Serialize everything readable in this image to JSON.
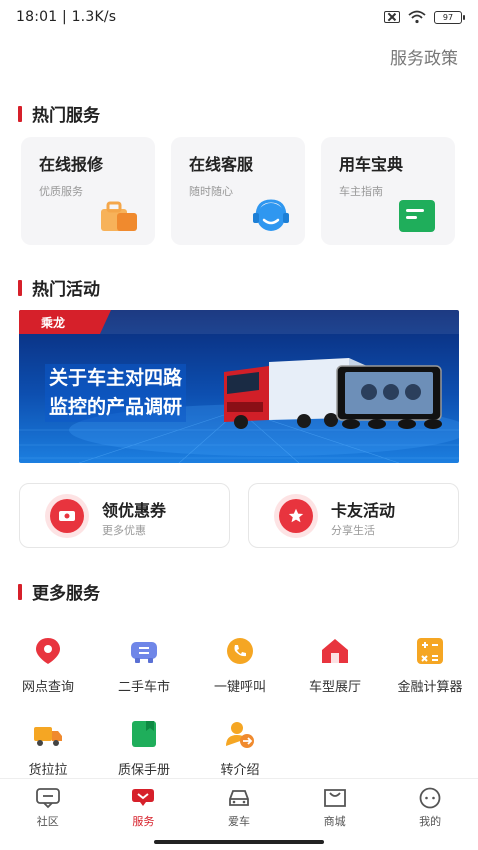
{
  "status_bar": {
    "time": "18:01",
    "speed": "1.3K/s",
    "battery": "97"
  },
  "header": {
    "service_policy": "服务政策"
  },
  "hot_services": {
    "title": "热门服务",
    "cards": [
      {
        "title": "在线报修",
        "subtitle": "优质服务",
        "icon": "toolbox-icon"
      },
      {
        "title": "在线客服",
        "subtitle": "随时随心",
        "icon": "headset-icon"
      },
      {
        "title": "用车宝典",
        "subtitle": "车主指南",
        "icon": "guidebook-icon"
      }
    ]
  },
  "hot_activities": {
    "title": "热门活动",
    "banner": {
      "brand": "乘龙",
      "line1": "关于车主对四路",
      "line2": "监控的产品调研"
    },
    "promos": [
      {
        "title": "领优惠券",
        "subtitle": "更多优惠",
        "icon": "coupon-icon"
      },
      {
        "title": "卡友活动",
        "subtitle": "分享生活",
        "icon": "star-icon"
      }
    ]
  },
  "more_services": {
    "title": "更多服务",
    "items": [
      {
        "label": "网点查询",
        "icon": "location-pin-icon"
      },
      {
        "label": "二手车市",
        "icon": "used-car-icon"
      },
      {
        "label": "一键呼叫",
        "icon": "phone-icon"
      },
      {
        "label": "车型展厅",
        "icon": "showroom-icon"
      },
      {
        "label": "金融计算器",
        "icon": "calculator-icon"
      },
      {
        "label": "货拉拉",
        "icon": "delivery-truck-icon"
      },
      {
        "label": "质保手册",
        "icon": "warranty-book-icon"
      },
      {
        "label": "转介绍",
        "icon": "referral-icon"
      }
    ]
  },
  "bottom_nav": {
    "items": [
      {
        "label": "社区",
        "icon": "community-icon",
        "active": false
      },
      {
        "label": "服务",
        "icon": "service-icon",
        "active": true
      },
      {
        "label": "爱车",
        "icon": "car-icon",
        "active": false
      },
      {
        "label": "商城",
        "icon": "mall-icon",
        "active": false
      },
      {
        "label": "我的",
        "icon": "profile-icon",
        "active": false
      }
    ]
  },
  "colors": {
    "accent": "#d6202a",
    "muted": "#999999",
    "card_bg": "#f5f5f7"
  }
}
